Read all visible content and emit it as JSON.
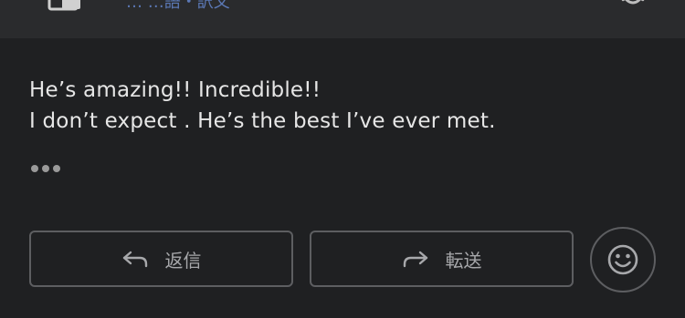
{
  "header": {
    "partial_text": "… …語・訳文",
    "left_icon": "app-icon",
    "right_icon": "gear-icon"
  },
  "message": {
    "line1": "He’s amazing!! Incredible!!",
    "line2": "I don’t expect . He’s the best I’ve ever met."
  },
  "more_icon": "more-dots-icon",
  "actions": {
    "reply_label": "返信",
    "forward_label": "転送",
    "emoji_icon": "smiley-icon"
  },
  "colors": {
    "background": "#1f2022",
    "header_bg": "#2a2b2d",
    "text": "#e6e6e6",
    "button_border": "#5d5e61",
    "button_text": "#a7a8ab",
    "header_text": "#5b78b5"
  }
}
